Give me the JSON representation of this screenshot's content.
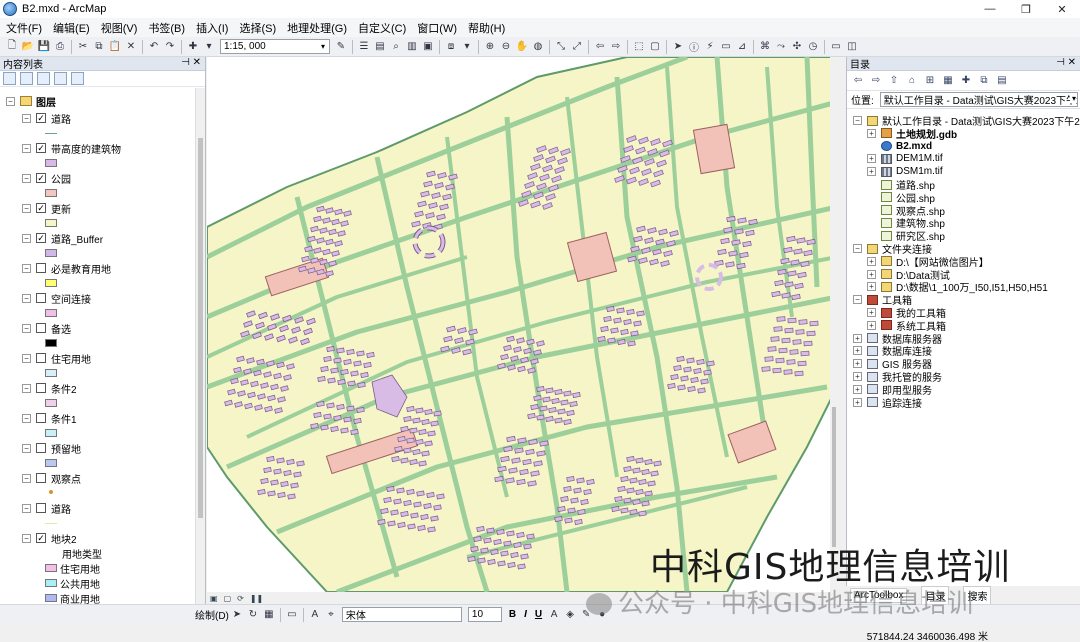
{
  "window": {
    "title": "B2.mxd - ArcMap",
    "controls": [
      "—",
      "❐",
      "✕"
    ]
  },
  "menu": [
    "文件(F)",
    "编辑(E)",
    "视图(V)",
    "书签(B)",
    "插入(I)",
    "选择(S)",
    "地理处理(G)",
    "自定义(C)",
    "窗口(W)",
    "帮助(H)"
  ],
  "toolbar": {
    "scale": "1:15, 000"
  },
  "toc": {
    "title": "内容列表",
    "layers_root": "图层",
    "layers": [
      {
        "name": "道路",
        "checked": true,
        "symbol": "line",
        "color": "#6aa58a"
      },
      {
        "name": "带高度的建筑物",
        "checked": true,
        "symbol": "fill",
        "color": "#d8b8e8"
      },
      {
        "name": "公园",
        "checked": true,
        "symbol": "fill",
        "color": "#f4c6c0"
      },
      {
        "name": "更新",
        "checked": true,
        "symbol": "fill",
        "color": "#f5f5c8"
      },
      {
        "name": "道路_Buffer",
        "checked": true,
        "symbol": "fill",
        "color": "#d0b8e8"
      },
      {
        "name": "必是教育用地",
        "checked": false,
        "symbol": "fill",
        "color": "#ffff70"
      },
      {
        "name": "空间连接",
        "checked": false,
        "symbol": "fill",
        "color": "#f0c0e8"
      },
      {
        "name": "备选",
        "checked": false,
        "symbol": "fill",
        "color": "#000000"
      },
      {
        "name": "住宅用地",
        "checked": false,
        "symbol": "fill",
        "color": "#d8eef8"
      },
      {
        "name": "条件2",
        "checked": false,
        "symbol": "fill",
        "color": "#f0d0e8"
      },
      {
        "name": "条件1",
        "checked": false,
        "symbol": "fill",
        "color": "#c8f0f8"
      },
      {
        "name": "预留地",
        "checked": false,
        "symbol": "fill",
        "color": "#b8c8f0"
      },
      {
        "name": "观察点",
        "checked": false,
        "symbol": "dot",
        "color": "#d19a2a"
      },
      {
        "name": "道路",
        "checked": false,
        "symbol": "line",
        "color": "#e8e8a0"
      },
      {
        "name": "地块2",
        "checked": true,
        "symbol": "none",
        "color": ""
      }
    ],
    "legend_field": "用地类型",
    "legend_items": [
      {
        "label": "住宅用地",
        "color": "#f5c0e8"
      },
      {
        "label": "公共用地",
        "color": "#a8f0f8"
      },
      {
        "label": "商业用地",
        "color": "#b0b8f8"
      }
    ]
  },
  "catalog": {
    "title": "目录",
    "location_label": "位置:",
    "location_value": "默认工作目录 - Data测试\\GIS大赛2023下午2",
    "items": [
      {
        "label": "默认工作目录 - Data测试\\GIS大赛2023下午2",
        "level": 0,
        "icon": "folder",
        "bold": false
      },
      {
        "label": "土地规划.gdb",
        "level": 1,
        "icon": "gdb",
        "bold": true
      },
      {
        "label": "B2.mxd",
        "level": 1,
        "icon": "mxd",
        "bold": true
      },
      {
        "label": "DEM1M.tif",
        "level": 1,
        "icon": "ras",
        "bold": false
      },
      {
        "label": "DSM1m.tif",
        "level": 1,
        "icon": "ras",
        "bold": false
      },
      {
        "label": "道路.shp",
        "level": 1,
        "icon": "shp",
        "bold": false
      },
      {
        "label": "公园.shp",
        "level": 1,
        "icon": "shp",
        "bold": false
      },
      {
        "label": "观察点.shp",
        "level": 1,
        "icon": "shp",
        "bold": false
      },
      {
        "label": "建筑物.shp",
        "level": 1,
        "icon": "shp",
        "bold": false
      },
      {
        "label": "研究区.shp",
        "level": 1,
        "icon": "shp",
        "bold": false
      },
      {
        "label": "文件夹连接",
        "level": 0,
        "icon": "folder",
        "bold": false
      },
      {
        "label": "D:\\【网站微信图片】",
        "level": 1,
        "icon": "folder",
        "bold": false
      },
      {
        "label": "D:\\Data测试",
        "level": 1,
        "icon": "folder",
        "bold": false
      },
      {
        "label": "D:\\数据\\1_100万_I50,I51,H50,H51",
        "level": 1,
        "icon": "folder",
        "bold": false
      },
      {
        "label": "工具箱",
        "level": 0,
        "icon": "tool",
        "bold": false
      },
      {
        "label": "我的工具箱",
        "level": 1,
        "icon": "tool",
        "bold": false
      },
      {
        "label": "系统工具箱",
        "level": 1,
        "icon": "tool",
        "bold": false
      },
      {
        "label": "数据库服务器",
        "level": 0,
        "icon": "srv",
        "bold": false
      },
      {
        "label": "数据库连接",
        "level": 0,
        "icon": "srv",
        "bold": false
      },
      {
        "label": "GIS 服务器",
        "level": 0,
        "icon": "srv",
        "bold": false
      },
      {
        "label": "我托管的服务",
        "level": 0,
        "icon": "srv",
        "bold": false
      },
      {
        "label": "即用型服务",
        "level": 0,
        "icon": "srv",
        "bold": false
      },
      {
        "label": "追踪连接",
        "level": 0,
        "icon": "srv",
        "bold": false
      }
    ],
    "tabs": [
      "ArcToolbox",
      "目录",
      "搜索"
    ]
  },
  "drawbar": {
    "draw_label": "绘制(D)",
    "font": "宋体",
    "size": "10",
    "bold": "B",
    "italic": "I",
    "underline": "U",
    "text_tool": "A"
  },
  "status": {
    "coords": "571844.24  3460036.498 米"
  },
  "watermark": {
    "main": "中科GIS地理信息培训",
    "sub": "公众号 · 中科GIS地理信息培训"
  },
  "map_colors": {
    "background": "#ffffff",
    "block": "#f5f5c8",
    "road": "#9ccf9a",
    "road_edge": "#5e9a6a",
    "building": "#d8bce6",
    "building_edge": "#7a5a8a",
    "park": "#f2c2b8"
  }
}
